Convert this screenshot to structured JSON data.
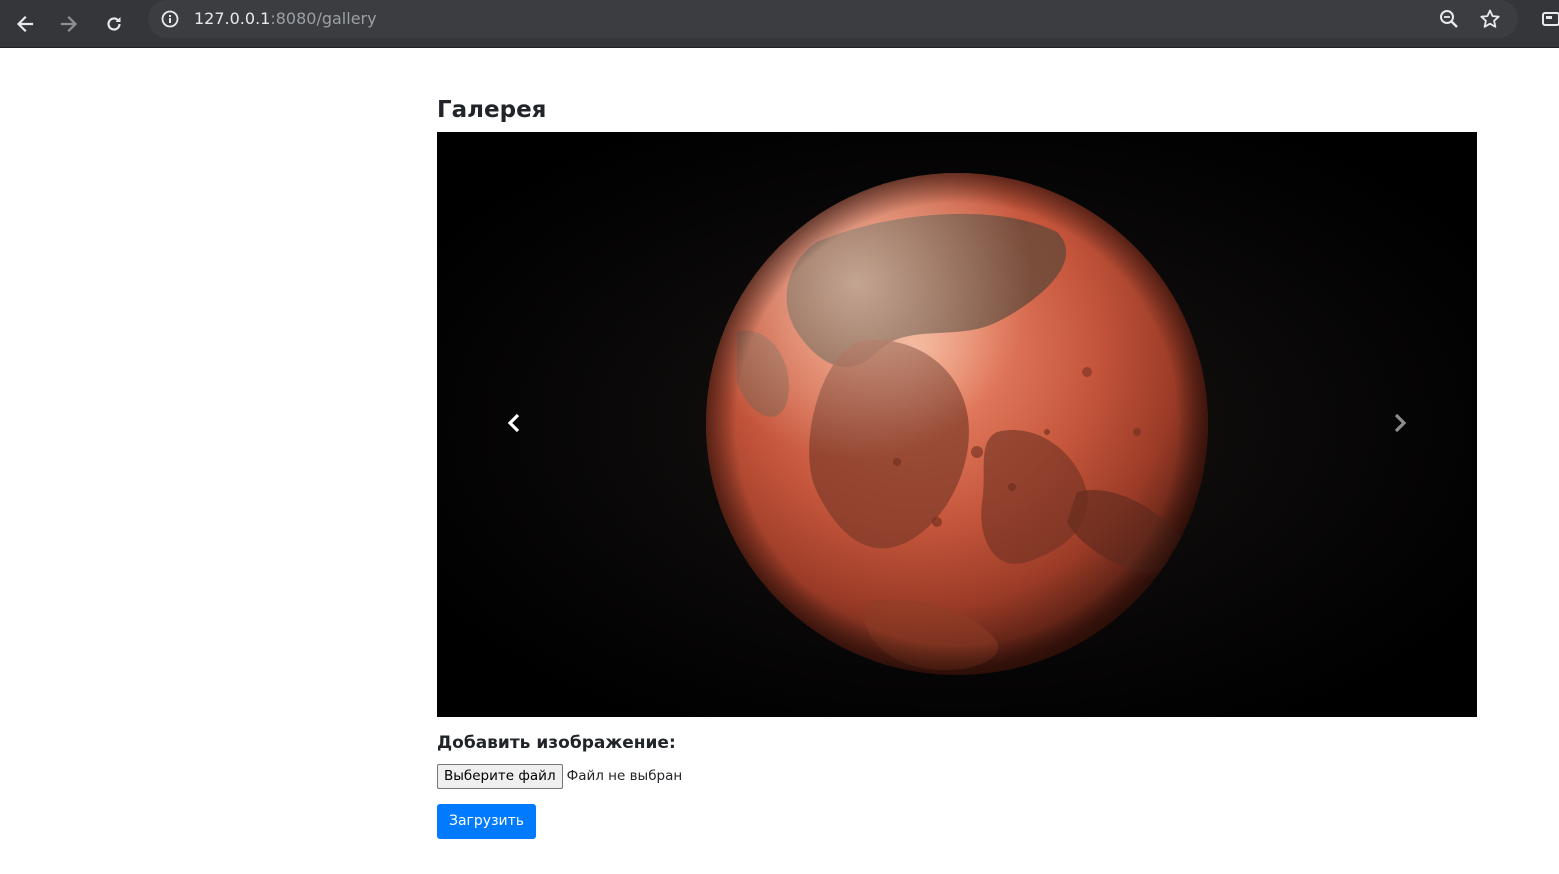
{
  "browser": {
    "url_host": "127.0.0.1",
    "url_path": ":8080/gallery",
    "icons": {
      "back": "back-arrow-icon",
      "forward": "forward-arrow-icon",
      "reload": "reload-icon",
      "site_info": "info-icon",
      "zoom": "zoom-icon",
      "bookmark": "star-icon",
      "extension": "extension-icon"
    }
  },
  "page": {
    "title": "Галерея",
    "carousel": {
      "prev_icon": "chevron-left-icon",
      "next_icon": "chevron-right-icon",
      "slide_image": "mars-planet"
    },
    "upload": {
      "label": "Добавить изображение:",
      "choose_button": "Выберите файл",
      "file_status": "Файл не выбран",
      "submit_button": "Загрузить"
    }
  },
  "colors": {
    "chrome_bg": "#35363a",
    "omnibox_bg": "#3c3d41",
    "primary": "#007bff",
    "text": "#212529"
  }
}
